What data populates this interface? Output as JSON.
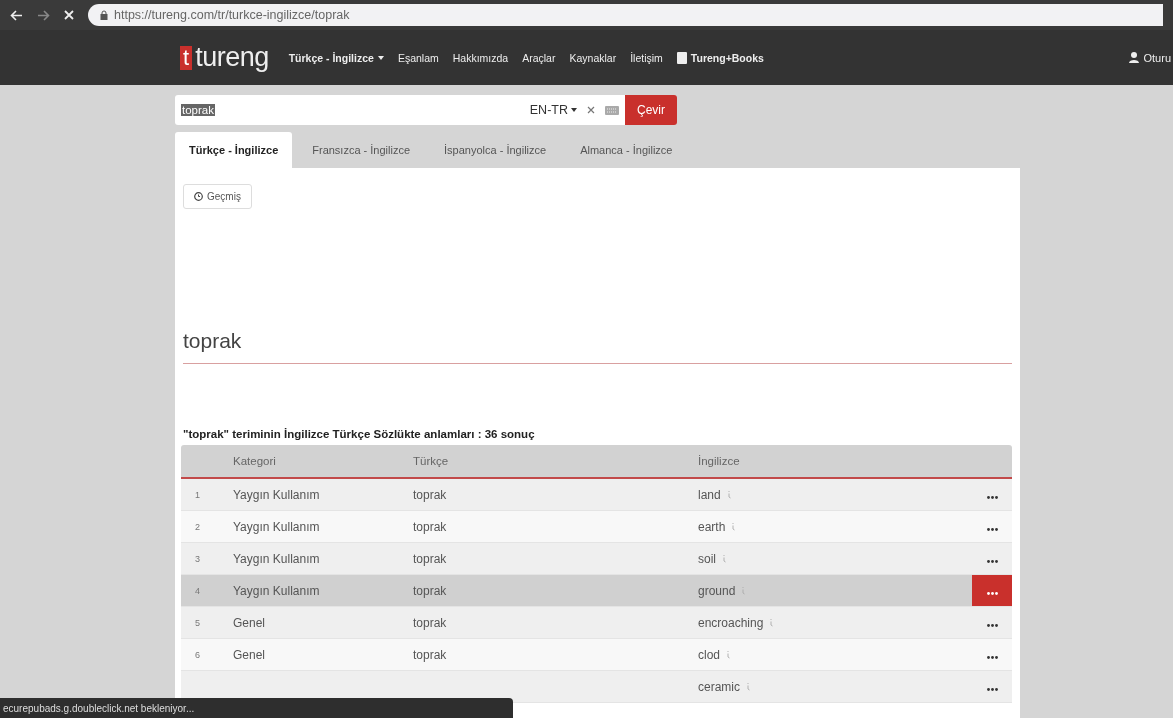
{
  "browser": {
    "url": "https://tureng.com/tr/turkce-ingilizce/toprak",
    "forward_disabled": true
  },
  "nav": {
    "logo_mark": "t",
    "logo_text": "tureng",
    "items": [
      {
        "label": "Türkçe - İngilizce",
        "kind": "dropdown"
      },
      {
        "label": "Eşanlam",
        "kind": "link"
      },
      {
        "label": "Hakkımızda",
        "kind": "link"
      },
      {
        "label": "Araçlar",
        "kind": "link"
      },
      {
        "label": "Kaynaklar",
        "kind": "link"
      },
      {
        "label": "İletişim",
        "kind": "link"
      },
      {
        "label": "Tureng+Books",
        "kind": "book"
      }
    ],
    "account": "Oturu"
  },
  "search": {
    "value": "toprak",
    "language": "EN-TR",
    "submit": "Çevir"
  },
  "tabs": [
    {
      "label": "Türkçe - İngilizce",
      "selected": true
    },
    {
      "label": "Fransızca - İngilizce",
      "selected": false
    },
    {
      "label": "İspanyolca - İngilizce",
      "selected": false
    },
    {
      "label": "Almanca - İngilizce",
      "selected": false
    }
  ],
  "history_button": "Geçmiş",
  "term": "toprak",
  "results_title": "\"toprak\" teriminin İngilizce Türkçe Sözlükte anlamları : 36 sonuç",
  "table": {
    "columns": [
      "Kategori",
      "Türkçe",
      "İngilizce"
    ],
    "rows": [
      {
        "number": "1",
        "category": "Yaygın Kullanım",
        "turkish": "toprak",
        "english": "land",
        "selected": false
      },
      {
        "number": "2",
        "category": "Yaygın Kullanım",
        "turkish": "toprak",
        "english": "earth",
        "selected": false
      },
      {
        "number": "3",
        "category": "Yaygın Kullanım",
        "turkish": "toprak",
        "english": "soil",
        "selected": false
      },
      {
        "number": "4",
        "category": "Yaygın Kullanım",
        "turkish": "toprak",
        "english": "ground",
        "selected": true
      },
      {
        "number": "5",
        "category": "Genel",
        "turkish": "toprak",
        "english": "encroaching",
        "selected": false
      },
      {
        "number": "6",
        "category": "Genel",
        "turkish": "toprak",
        "english": "clod",
        "selected": false
      },
      {
        "english": "ceramic",
        "selected": false
      }
    ]
  },
  "status_bar": "ecurepubads.g.doubleclick.net bekleniyor..."
}
